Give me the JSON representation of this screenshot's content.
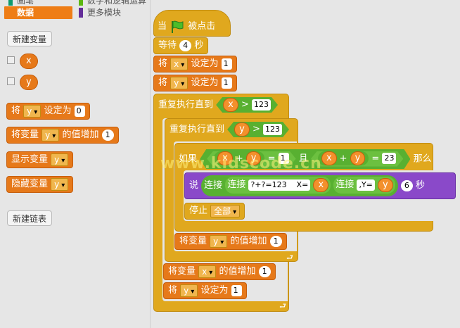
{
  "palette": {
    "categories": [
      {
        "label": "画笔",
        "color": "#0e9a6c"
      },
      {
        "label": "数字和逻辑运算",
        "color": "#5cb712"
      },
      {
        "label": "数据",
        "color": "#ee7d16",
        "selected": true
      },
      {
        "label": "更多模块",
        "color": "#632d99"
      }
    ],
    "new_variable_button": "新建变量",
    "variables": [
      "x",
      "y"
    ],
    "set_block": {
      "prefix": "将",
      "var": "y",
      "mid": "设定为",
      "value": "0"
    },
    "change_block": {
      "prefix": "将变量",
      "var": "y",
      "mid": "的值增加",
      "value": "1"
    },
    "show_block": {
      "prefix": "显示变量",
      "var": "y"
    },
    "hide_block": {
      "prefix": "隐藏变量",
      "var": "y"
    },
    "new_list_button": "新建链表"
  },
  "script": {
    "hat": {
      "prefix": "当",
      "suffix": "被点击"
    },
    "wait": {
      "prefix": "等待",
      "value": "4",
      "suffix": "秒"
    },
    "set_x": {
      "prefix": "将",
      "var": "x",
      "mid": "设定为",
      "value": "1"
    },
    "set_y": {
      "prefix": "将",
      "var": "y",
      "mid": "设定为",
      "value": "1"
    },
    "repeat_outer": {
      "label": "重复执行直到",
      "var": "x",
      "op": ">",
      "value": "123"
    },
    "repeat_inner": {
      "label": "重复执行直到",
      "var": "y",
      "op": ">",
      "value": "123"
    },
    "if": {
      "label": "如果",
      "a": "x",
      "b": "y",
      "op1": "+",
      "eq1": "=",
      "v1": "1",
      "and": "且",
      "c": "x",
      "op2": "+",
      "d": "y",
      "eq2": "=",
      "v2": "23",
      "then": "那么"
    },
    "say": {
      "label": "说",
      "join": "连接",
      "text1": "?+?=123    X=",
      "var1": "x",
      "text2": ",Y=",
      "var2": "y",
      "secs": "6",
      "secs_label": "秒"
    },
    "stop": {
      "label": "停止",
      "option": "全部"
    },
    "change_y": {
      "prefix": "将变量",
      "var": "y",
      "mid": "的值增加",
      "value": "1"
    },
    "change_x": {
      "prefix": "将变量",
      "var": "x",
      "mid": "的值增加",
      "value": "1"
    },
    "set_y2": {
      "prefix": "将",
      "var": "y",
      "mid": "设定为",
      "value": "1"
    }
  },
  "watermark": "www.kidscode.cn"
}
